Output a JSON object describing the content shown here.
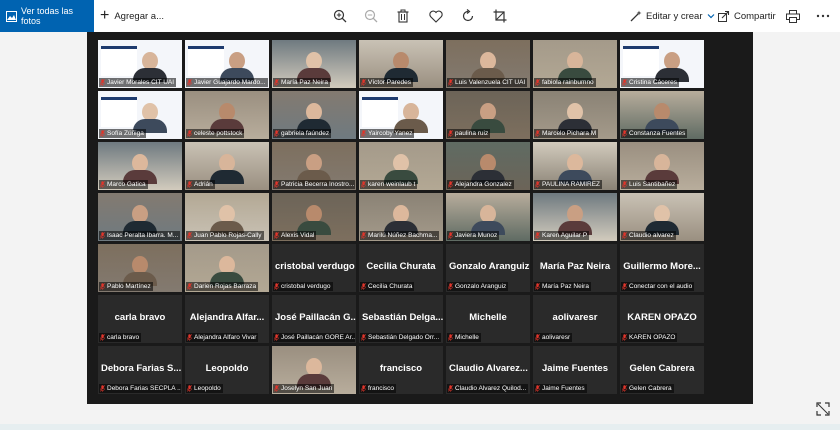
{
  "toolbar": {
    "all_photos_label": "Ver todas las fotos",
    "add_to_label": "Agregar a...",
    "edit_create_label": "Editar y crear",
    "share_label": "Compartir",
    "icons": [
      "zoom-in-icon",
      "zoom-out-icon",
      "delete-icon",
      "favorite-icon",
      "rotate-icon",
      "crop-icon",
      "print-icon",
      "more-icon"
    ]
  },
  "colors": {
    "accent": "#0063b1",
    "photo_bg": "#1a1a1a",
    "tile_dark": "#2a2a2a",
    "mic_red": "#e0352b"
  },
  "tiles": [
    {
      "label": "Javier Morales CIT UAI",
      "kind": "slide"
    },
    {
      "label": "Javier Guajardo Mardo...",
      "kind": "slide"
    },
    {
      "label": "María Paz Neira",
      "kind": "video"
    },
    {
      "label": "Víctor Paredes",
      "kind": "video"
    },
    {
      "label": "Luis Valenzuela CIT UAI",
      "kind": "video"
    },
    {
      "label": "fabiola rainbumno",
      "kind": "video"
    },
    {
      "label": "Cristina Cáceres",
      "kind": "slide"
    },
    {
      "label": "Sofía Zúñiga",
      "kind": "slide"
    },
    {
      "label": "celeste pottstock",
      "kind": "video"
    },
    {
      "label": "gabriela faúndez",
      "kind": "video"
    },
    {
      "label": "Yaircoby Yanez",
      "kind": "slide"
    },
    {
      "label": "paulina ruiz",
      "kind": "video"
    },
    {
      "label": "Marcelo Pichara M",
      "kind": "video"
    },
    {
      "label": "Constanza Fuentes",
      "kind": "video"
    },
    {
      "label": "Marco Gatica",
      "kind": "video"
    },
    {
      "label": "Adrián",
      "kind": "video"
    },
    {
      "label": "Patricia Becerra Inostro...",
      "kind": "video"
    },
    {
      "label": "karen weinlaub t",
      "kind": "video"
    },
    {
      "label": "Alejandra Gonzalez",
      "kind": "video"
    },
    {
      "label": "PAULINA RAMIREZ",
      "kind": "video"
    },
    {
      "label": "Luis Santibañez",
      "kind": "video"
    },
    {
      "label": "Isaac Peralta Ibarra. M...",
      "kind": "video"
    },
    {
      "label": "Juan Pablo Rojas-Cally",
      "kind": "video"
    },
    {
      "label": "Alexis Vidal",
      "kind": "video"
    },
    {
      "label": "Marilú Núñez Bachma...",
      "kind": "video"
    },
    {
      "label": "Javiera Munoz",
      "kind": "video"
    },
    {
      "label": "Karen Aguilar P",
      "kind": "video"
    },
    {
      "label": "Claudio alvarez",
      "kind": "video"
    },
    {
      "label": "Pablo Martínez",
      "kind": "video"
    },
    {
      "label": "Darien Rojas Barraza",
      "kind": "video"
    },
    {
      "big": "cristobal verdugo",
      "label": "cristobal verdugo",
      "kind": "name"
    },
    {
      "big": "Cecilia Churata",
      "label": "Cecilia Churata",
      "kind": "name"
    },
    {
      "big": "Gonzalo Aranguiz",
      "label": "Gonzalo Aranguiz",
      "kind": "name"
    },
    {
      "big": "María Paz Neira",
      "label": "María Paz Neira",
      "kind": "name"
    },
    {
      "big": "Guillermo More...",
      "label": "Conectar con el audio",
      "kind": "name"
    },
    {
      "big": "carla bravo",
      "label": "carla bravo",
      "kind": "name"
    },
    {
      "big": "Alejandra Alfar...",
      "label": "Alejandra Alfaro Vivar",
      "kind": "name"
    },
    {
      "big": "José Paillacán G...",
      "label": "José Paillacán GORE Ar...",
      "kind": "name"
    },
    {
      "big": "Sebastián Delga...",
      "label": "Sebastián Delgado Orr...",
      "kind": "name"
    },
    {
      "big": "Michelle",
      "label": "Michelle",
      "kind": "name"
    },
    {
      "big": "aolivaresr",
      "label": "aolivaresr",
      "kind": "name"
    },
    {
      "big": "KAREN OPAZO",
      "label": "KAREN OPAZO",
      "kind": "name"
    },
    {
      "big": "Debora Farias S...",
      "label": "Debora Farias SECPLA ...",
      "kind": "name"
    },
    {
      "big": "Leopoldo",
      "label": "Leopoldo",
      "kind": "name"
    },
    {
      "label": "Joselyn San Juan",
      "kind": "video"
    },
    {
      "big": "francisco",
      "label": "francisco",
      "kind": "name"
    },
    {
      "big": "Claudio Alvarez...",
      "label": "Claudio Alvarez Quilod...",
      "kind": "name"
    },
    {
      "big": "Jaime Fuentes",
      "label": "Jaime Fuentes",
      "kind": "name"
    },
    {
      "big": "Gelen Cabrera",
      "label": "Gelen Cabrera",
      "kind": "name"
    }
  ]
}
